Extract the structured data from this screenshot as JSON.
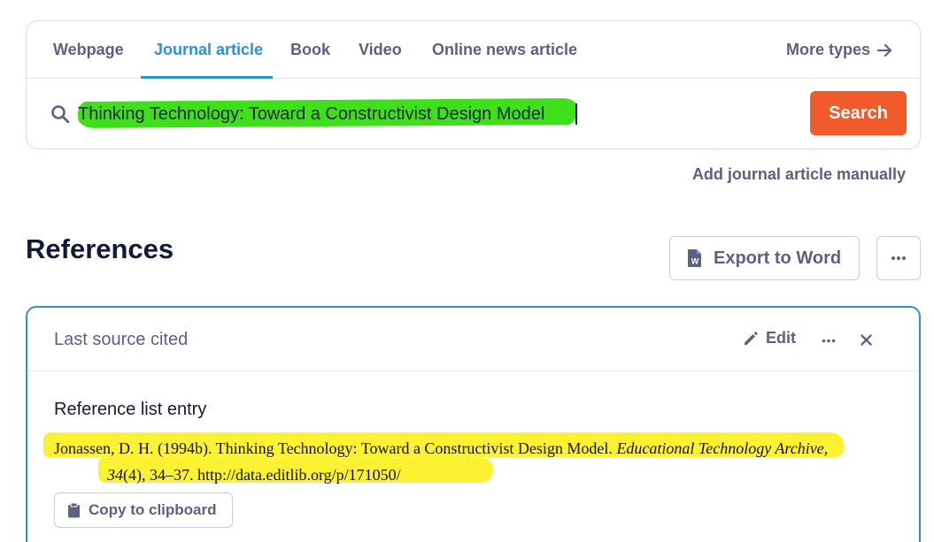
{
  "tabs": [
    {
      "label": "Webpage",
      "active": false
    },
    {
      "label": "Journal article",
      "active": true
    },
    {
      "label": "Book",
      "active": false
    },
    {
      "label": "Video",
      "active": false
    },
    {
      "label": "Online news article",
      "active": false
    }
  ],
  "more_types_label": "More types",
  "search": {
    "value": "Thinking Technology: Toward a Constructivist Design Model",
    "button_label": "Search"
  },
  "add_manual_label": "Add journal article manually",
  "references": {
    "title": "References",
    "export_label": "Export to Word"
  },
  "last_source": {
    "title": "Last source cited",
    "edit_label": "Edit",
    "entry_label": "Reference list entry",
    "entry": {
      "authors_year": "Jonassen, D. H. (1994b). Thinking Technology: Toward a Constructivist Design Model. ",
      "journal": "Educational Technology Archive",
      "sep1": ", ",
      "volume": "34",
      "issue_pages": "(4), 34–37. ",
      "url": "http://data.editlib.org/p/171050/"
    },
    "copy_label": "Copy to clipboard"
  },
  "colors": {
    "accent": "#2f8fd8",
    "search_button": "#f15a2b",
    "highlight_green": "#3fe01a",
    "highlight_yellow": "#fdf231"
  }
}
